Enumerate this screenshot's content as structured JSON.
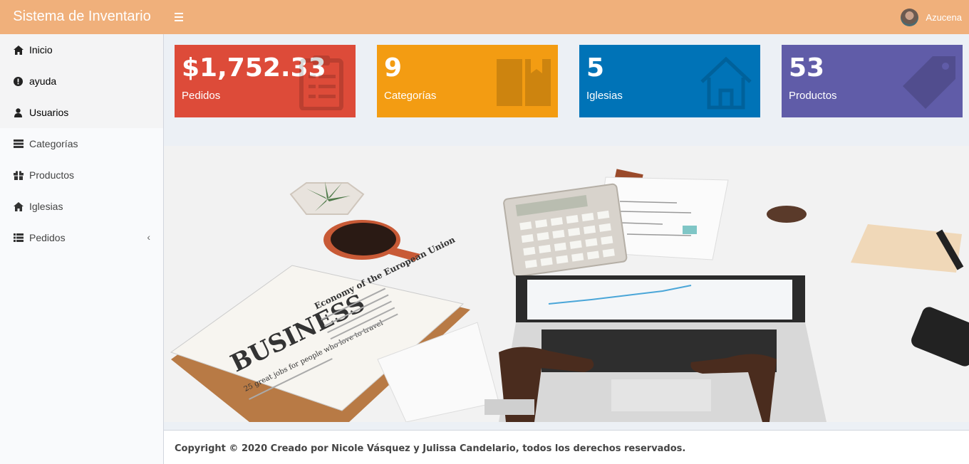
{
  "header": {
    "brand": "Sistema de Inventario",
    "user_name": "Azucena"
  },
  "sidebar": {
    "items": [
      {
        "label": "Inicio",
        "icon": "home-icon"
      },
      {
        "label": "ayuda",
        "icon": "info-icon"
      },
      {
        "label": "Usuarios",
        "icon": "user-icon"
      },
      {
        "label": "Categorías",
        "icon": "server-icon"
      },
      {
        "label": "Productos",
        "icon": "gift-icon"
      },
      {
        "label": "Iglesias",
        "icon": "home-icon"
      },
      {
        "label": "Pedidos",
        "icon": "list-icon"
      }
    ]
  },
  "stats": [
    {
      "value": "$1,752.33",
      "label": "Pedidos",
      "color": "#dd4b39",
      "icon": "clipboard-icon"
    },
    {
      "value": "9",
      "label": "Categorías",
      "color": "#f39c12",
      "icon": "book-icon"
    },
    {
      "value": "5",
      "label": "Iglesias",
      "color": "#0073b7",
      "icon": "home-icon"
    },
    {
      "value": "53",
      "label": "Productos",
      "color": "#605ca8",
      "icon": "tag-icon"
    }
  ],
  "banner": {
    "newspaper_headline": "BUSINESS",
    "newspaper_subhead": "Economy of the European Union",
    "newspaper_line": "25 great jobs for people who love to travel"
  },
  "footer": {
    "text": "Copyright © 2020 Creado por Nicole Vásquez y Julissa Candelario, todos los derechos reservados."
  }
}
